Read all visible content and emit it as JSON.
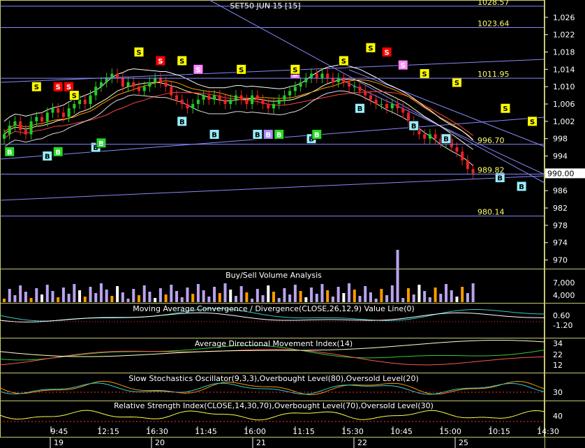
{
  "title": "SET50 JUN 15   [15]",
  "colors": {
    "bg": "#000000",
    "frame": "#c8c870",
    "grid": "#5a5a2e",
    "axis_text": "#ffffff",
    "level_text": "#ffff66",
    "trend": "#8888ff",
    "candle_up": "#22cc22",
    "candle_down": "#ee2222",
    "vol_purple": "#b9a3ee",
    "vol_orange": "#ff9900",
    "vol_white": "#ffffff",
    "last_price_bg": "#ffffff",
    "signal_sell": "#ffff00",
    "signal_sell_red": "#ff0000",
    "signal_sell_pink": "#ff88ff",
    "signal_buy": "#22dd22",
    "signal_buy_cyan": "#99eeff",
    "signal_buy_purple": "#aa88ff"
  },
  "price_axis": {
    "labels": [
      "1,026",
      "1,022",
      "1,018",
      "1,014",
      "1,010",
      "1,006",
      "1,002",
      "998",
      "994",
      "990",
      "986",
      "982",
      "978",
      "974",
      "970"
    ],
    "last_price": "990.00"
  },
  "levels": [
    {
      "label": "1028.57",
      "value": 1028.57
    },
    {
      "label": "1023.64",
      "value": 1023.64
    },
    {
      "label": "1011.95",
      "value": 1011.95
    },
    {
      "label": "996.70",
      "value": 996.7
    },
    {
      "label": "989.82",
      "value": 989.82
    },
    {
      "label": "980.14",
      "value": 980.14
    }
  ],
  "time_axis": {
    "times": [
      "9:45",
      "12:15",
      "16:30",
      "11:45",
      "16:00",
      "11:15",
      "15:30",
      "10:45",
      "15:00",
      "10:15",
      "14:30"
    ],
    "days": [
      "19",
      "20",
      "21",
      "22",
      "25"
    ]
  },
  "panels": {
    "volume": {
      "title": "Buy/Sell Volume Analysis",
      "axis": [
        "7,000",
        "4,000"
      ]
    },
    "macd": {
      "title": "Moving Average Convergence / Divergence(CLOSE,26,12,9) Value Line(0)",
      "axis": [
        "0.60",
        "-1.20"
      ]
    },
    "adx": {
      "title": "Average Directional Movement Index(14)",
      "axis": [
        "34",
        "22",
        "12"
      ]
    },
    "stoch": {
      "title": "Slow Stochastics Oscillator(9,3,3),Overbought Level(80),Oversold Level(20)",
      "axis": [
        "30"
      ]
    },
    "rsi": {
      "title": "Relative Strength Index(CLOSE,14,30,70),Overbought Level(70),Oversold Level(30)",
      "axis": [
        "40"
      ]
    }
  },
  "chart_data": {
    "type": "line",
    "series_kind": "candlestick",
    "title": "SET50 JUN 15   [15]",
    "ylim": [
      968,
      1030
    ],
    "close": [
      999,
      1001,
      1002,
      1000,
      999,
      1002,
      1003,
      1002,
      1004,
      1005,
      1004,
      1003,
      1005,
      1006,
      1007,
      1006,
      1008,
      1010,
      1011,
      1012,
      1013,
      1012,
      1010,
      1011,
      1010,
      1009,
      1010,
      1011,
      1012,
      1011,
      1010,
      1008,
      1007,
      1006,
      1005,
      1006,
      1007,
      1008,
      1007,
      1008,
      1007,
      1006,
      1007,
      1008,
      1007,
      1006,
      1008,
      1007,
      1006,
      1005,
      1006,
      1007,
      1008,
      1009,
      1010,
      1011,
      1012,
      1013,
      1012,
      1013,
      1012,
      1011,
      1012,
      1011,
      1010,
      1010,
      1009,
      1008,
      1007,
      1006,
      1006,
      1005,
      1006,
      1005,
      1004,
      1002,
      1000,
      999,
      998,
      999,
      998,
      997,
      998,
      996,
      995,
      993,
      991,
      990
    ],
    "signals": [
      {
        "t": "B",
        "i": 1,
        "c": "signal_buy",
        "v": 995
      },
      {
        "t": "S",
        "i": 6,
        "c": "signal_sell",
        "v": 1010
      },
      {
        "t": "B",
        "i": 8,
        "c": "signal_buy_cyan",
        "v": 994
      },
      {
        "t": "B",
        "i": 10,
        "c": "signal_buy",
        "v": 995
      },
      {
        "t": "S",
        "i": 10,
        "c": "signal_sell_red",
        "v": 1010
      },
      {
        "t": "S",
        "i": 12,
        "c": "signal_sell_red",
        "v": 1010
      },
      {
        "t": "S",
        "i": 13,
        "c": "signal_sell",
        "v": 1008
      },
      {
        "t": "B",
        "i": 17,
        "c": "signal_buy_cyan",
        "v": 996
      },
      {
        "t": "B",
        "i": 18,
        "c": "signal_buy",
        "v": 997
      },
      {
        "t": "S",
        "i": 25,
        "c": "signal_sell",
        "v": 1018
      },
      {
        "t": "S",
        "i": 29,
        "c": "signal_sell_red",
        "v": 1016
      },
      {
        "t": "S",
        "i": 33,
        "c": "signal_sell",
        "v": 1016
      },
      {
        "t": "B",
        "i": 33,
        "c": "signal_buy_cyan",
        "v": 1002
      },
      {
        "t": "S",
        "i": 36,
        "c": "signal_sell_pink",
        "v": 1014
      },
      {
        "t": "B",
        "i": 39,
        "c": "signal_buy_cyan",
        "v": 999
      },
      {
        "t": "S",
        "i": 44,
        "c": "signal_sell",
        "v": 1014
      },
      {
        "t": "B",
        "i": 47,
        "c": "signal_buy_cyan",
        "v": 999
      },
      {
        "t": "B",
        "i": 49,
        "c": "signal_buy_purple",
        "v": 999
      },
      {
        "t": "B",
        "i": 51,
        "c": "signal_buy",
        "v": 999
      },
      {
        "t": "S",
        "i": 54,
        "c": "signal_sell_pink",
        "v": 1013
      },
      {
        "t": "S",
        "i": 54,
        "c": "signal_sell",
        "v": 1014
      },
      {
        "t": "B",
        "i": 57,
        "c": "signal_buy_cyan",
        "v": 998
      },
      {
        "t": "B",
        "i": 58,
        "c": "signal_buy",
        "v": 999
      },
      {
        "t": "S",
        "i": 63,
        "c": "signal_sell",
        "v": 1016
      },
      {
        "t": "B",
        "i": 66,
        "c": "signal_buy_cyan",
        "v": 1005
      },
      {
        "t": "S",
        "i": 68,
        "c": "signal_sell",
        "v": 1019
      },
      {
        "t": "S",
        "i": 71,
        "c": "signal_sell_red",
        "v": 1018
      },
      {
        "t": "S",
        "i": 74,
        "c": "signal_sell_pink",
        "v": 1015
      },
      {
        "t": "S",
        "i": 78,
        "c": "signal_sell",
        "v": 1013
      },
      {
        "t": "B",
        "i": 76,
        "c": "signal_buy_cyan",
        "v": 1001
      },
      {
        "t": "B",
        "i": 82,
        "c": "signal_buy_cyan",
        "v": 998
      },
      {
        "t": "S",
        "i": 84,
        "c": "signal_sell",
        "v": 1011
      },
      {
        "t": "B",
        "i": 92,
        "c": "signal_buy_cyan",
        "v": 989
      },
      {
        "t": "S",
        "i": 93,
        "c": "signal_sell",
        "v": 1005
      },
      {
        "t": "B",
        "i": 96,
        "c": "signal_buy_cyan",
        "v": 987
      },
      {
        "t": "S",
        "i": 99,
        "c": "signal_sell",
        "v": 1002
      }
    ]
  }
}
